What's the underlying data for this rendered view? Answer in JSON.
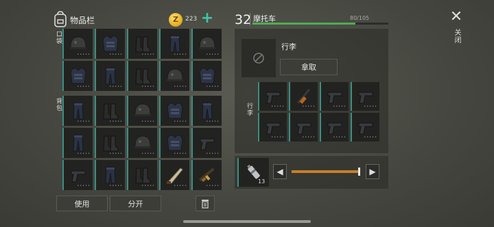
{
  "inventory": {
    "title": "物品栏",
    "coins": "223",
    "add_symbol": "+",
    "coin_symbol": "Z",
    "pocket_label": "口袋",
    "backpack_label": "背包",
    "pocket_items": [
      "helmet",
      "armor",
      "boots",
      "pants",
      "helmet",
      "armor",
      "pants",
      "boots",
      "helmet",
      "armor"
    ],
    "backpack_items": [
      "pants",
      "boots",
      "helmet",
      "armor",
      "pants",
      "pants",
      "boots",
      "helmet",
      "armor",
      "pistol",
      "pistol",
      "pants",
      "boots",
      "machete",
      "rifle"
    ],
    "use_button": "使用",
    "split_button": "分开"
  },
  "vehicle": {
    "level": "32",
    "name": "摩托车",
    "capacity": "80/105",
    "capacity_fraction": 0.76,
    "luggage_label": "行李",
    "take_button": "拿取",
    "side_label": "行李",
    "weapons": [
      "pistol",
      "sniper",
      "pistol",
      "pistol",
      "pistol",
      "pistol",
      "pistol",
      "pistol"
    ]
  },
  "ammo": {
    "count": "13",
    "slider_fraction": 1.0
  },
  "close": {
    "symbol": "✕",
    "label": "关闭"
  },
  "colors": {
    "slot_accent": "#3a8f86",
    "progress": "#4caf50",
    "slider": "#c87f2a",
    "add": "#3cc8a8"
  }
}
